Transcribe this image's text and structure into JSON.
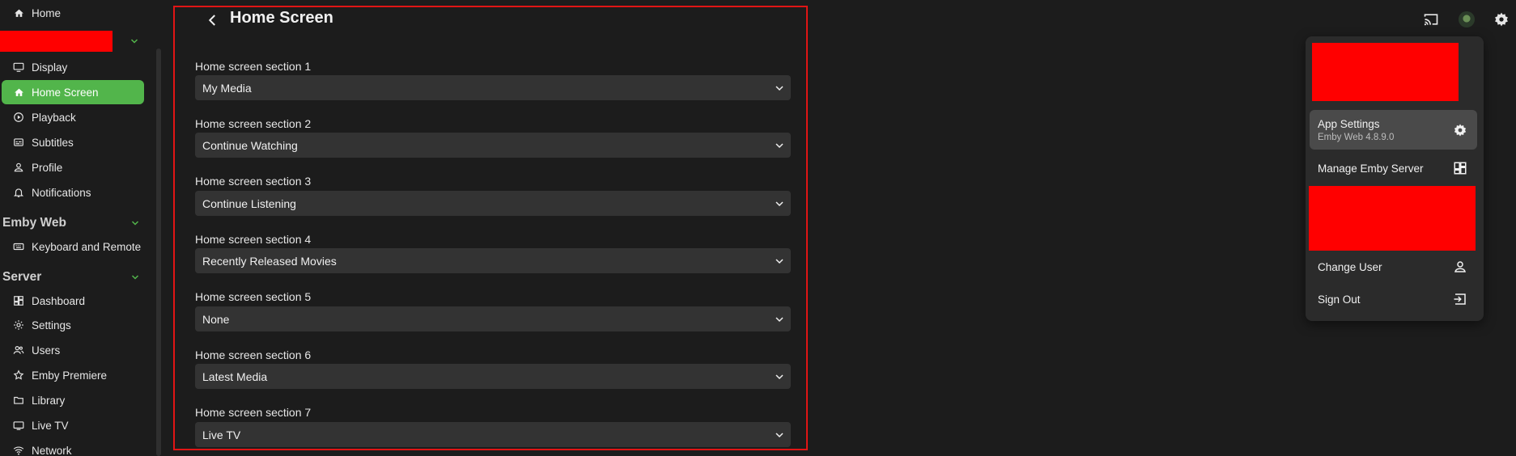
{
  "sidebar": {
    "home": "Home",
    "user_items": [
      {
        "label": "Display",
        "icon": "display-icon"
      },
      {
        "label": "Home Screen",
        "icon": "home-icon"
      },
      {
        "label": "Playback",
        "icon": "playback-icon"
      },
      {
        "label": "Subtitles",
        "icon": "subtitles-icon"
      },
      {
        "label": "Profile",
        "icon": "profile-icon"
      },
      {
        "label": "Notifications",
        "icon": "bell-icon"
      }
    ],
    "emby_web_heading": "Emby Web",
    "emby_web_items": [
      {
        "label": "Keyboard and Remote",
        "icon": "keyboard-icon"
      }
    ],
    "server_heading": "Server",
    "server_items": [
      {
        "label": "Dashboard",
        "icon": "dashboard-icon"
      },
      {
        "label": "Settings",
        "icon": "gear-icon"
      },
      {
        "label": "Users",
        "icon": "users-icon"
      },
      {
        "label": "Emby Premiere",
        "icon": "star-icon"
      },
      {
        "label": "Library",
        "icon": "folder-icon"
      },
      {
        "label": "Live TV",
        "icon": "tv-icon"
      },
      {
        "label": "Network",
        "icon": "wifi-icon"
      }
    ]
  },
  "main": {
    "title": "Home Screen",
    "sections": [
      {
        "label": "Home screen section 1",
        "value": "My Media"
      },
      {
        "label": "Home screen section 2",
        "value": "Continue Watching"
      },
      {
        "label": "Home screen section 3",
        "value": "Continue Listening"
      },
      {
        "label": "Home screen section 4",
        "value": "Recently Released Movies"
      },
      {
        "label": "Home screen section 5",
        "value": "None"
      },
      {
        "label": "Home screen section 6",
        "value": "Latest Media"
      },
      {
        "label": "Home screen section 7",
        "value": "Live TV"
      }
    ]
  },
  "menu": {
    "app_settings": "App Settings",
    "app_version": "Emby Web 4.8.9.0",
    "manage_server": "Manage Emby Server",
    "change_user": "Change User",
    "sign_out": "Sign Out"
  },
  "colors": {
    "accent": "#52b54b",
    "redaction": "#ff0000",
    "frame": "#e01515",
    "background": "#1c1c1c"
  }
}
